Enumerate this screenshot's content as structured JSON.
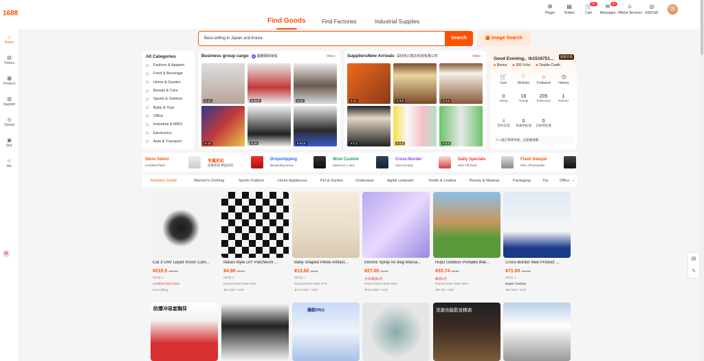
{
  "brand": {
    "logo": "1688"
  },
  "header": {
    "tabs": [
      {
        "label": "Find Goods"
      },
      {
        "label": "Find Factories"
      },
      {
        "label": "Industrial Supplies"
      }
    ],
    "tools": [
      {
        "label": "Plugin",
        "icon": "puzzle-icon"
      },
      {
        "label": "Orders",
        "icon": "orders-icon"
      },
      {
        "label": "Cart",
        "icon": "cart-icon",
        "badge": "99+"
      },
      {
        "label": "Messages",
        "icon": "message-icon",
        "badge": "99+"
      },
      {
        "label": "Official Services",
        "icon": "user-icon"
      },
      {
        "label": "EN/USD",
        "icon": "globe-icon"
      }
    ]
  },
  "sidebar": {
    "items": [
      {
        "label": "Home",
        "icon": "home-icon"
      },
      {
        "label": "Orders",
        "icon": "orders-icon"
      },
      {
        "label": "Product",
        "icon": "grid-icon"
      },
      {
        "label": "Supplier",
        "icon": "store-icon"
      },
      {
        "label": "Global",
        "icon": "globe-icon"
      },
      {
        "label": "Dist.",
        "icon": "distribution-icon"
      },
      {
        "label": "Me",
        "icon": "user-icon"
      }
    ]
  },
  "search": {
    "value": "Best-selling in Japan and Korea",
    "button": "Search",
    "image_search": "Image Search"
  },
  "categories": {
    "title": "All Categories",
    "items": [
      "Fashion & Apparel",
      "Food & Beverage",
      "Home & Garden",
      "Beauty & Care",
      "Sports & Outdoor",
      "Baby & Toys",
      "Office",
      "Industrial & MRO",
      "Electronics",
      "Auto & Transport"
    ]
  },
  "business_group": {
    "title": "Business group cargo",
    "subtitle": "超酷网袜家俱",
    "view": "View ›",
    "prices": [
      "¥ 16",
      "¥ 30.9",
      "¥ 19",
      "¥ 18",
      "¥ 25",
      "¥ 53.9"
    ]
  },
  "suppliers_new": {
    "title": "SuppliersNew Arrivals",
    "subtitle": "深圳市兴慧达科技有限公司",
    "view": "View ›",
    "prices": [
      "¥ 22",
      "¥ 3.5",
      "¥ 4.5",
      "¥ 2.2",
      "¥ 6.8",
      "¥ 6.8"
    ]
  },
  "greeting": {
    "text": "Good Evening，tb1518751...",
    "member_badge": "超级买家",
    "vouchers": [
      "Bonus",
      "300 Vchs",
      "Double Credit"
    ],
    "quick": [
      {
        "label": "Cart",
        "icon": "cart-icon"
      },
      {
        "label": "Wishlist",
        "icon": "heart-icon"
      },
      {
        "label": "Followed",
        "icon": "store-icon"
      },
      {
        "label": "History",
        "icon": "history-icon"
      }
    ],
    "stats": [
      {
        "value": "0",
        "label": "ToPay"
      },
      {
        "value": "16",
        "label": "ToShip"
      },
      {
        "value": "205",
        "label": "ToReceive"
      },
      {
        "value": "1",
        "label": "Refund"
      }
    ],
    "stats2": [
      {
        "value": "4",
        "label": "签约异常"
      },
      {
        "value": "0",
        "label": "签收待处理"
      },
      {
        "value": "0",
        "label": "已收待处理"
      }
    ],
    "notice": "1笔订单待付款，已逾期请重"
  },
  "promo_strip": [
    {
      "title": "Store Select",
      "sub": "Certified Flash",
      "color": "#ff5000"
    },
    {
      "title": "专属折扣",
      "sub": "优惠券领 特品有机",
      "color": "#ff5000"
    },
    {
      "title": "Dropshipping",
      "sub": "Bestselling items",
      "color": "#1a6cff"
    },
    {
      "title": "Wow Custom",
      "sub": "Minimum 1 Item",
      "color": "#17a34a"
    },
    {
      "title": "Cross-Border",
      "sub": "Fast Hot Buy",
      "color": "#8a3cf0"
    },
    {
      "title": "Daily Specials",
      "sub": "50% Off Rush",
      "color": "#ff2a2a"
    },
    {
      "title": "Flash Sample",
      "sub": "50% off bestseller",
      "color": "#ff5000"
    }
  ],
  "category_tabs": [
    "Selected Goods",
    "Women's Clothing",
    "Sports Outdoor",
    "Home Appliances",
    "Pet & Garden",
    "Underwear",
    "digital computer",
    "Textile & Leather",
    "Beauty & Makeup",
    "Packaging",
    "Toy",
    "Office"
  ],
  "products": [
    {
      "name": "Cat 3 UAV Liquid Vision Cam...",
      "price": "¥210.0",
      "old": "¥31.76",
      "moq": "MOQ 1",
      "tag": "Certified Merchant",
      "meta": "Hot selling"
    },
    {
      "name": "Italian-Style DIY Patchwork ...",
      "price": "¥4.90",
      "old": "¥0.73",
      "moq": "MOQ 3",
      "tag": "Repurchase Rate 83%",
      "meta": "★5   20K+ sold"
    },
    {
      "name": "Baby Shaped Pillow Artifact...",
      "price": "¥13.60",
      "old": "¥2.38",
      "moq": "MOQ 1",
      "tag": "Repurchase Rate 47%",
      "meta": "★4.8   20K+ sold"
    },
    {
      "name": "Electric Spray Air Bag Massa...",
      "price": "¥27.00",
      "old": "¥4.08",
      "moq": "分享再减2元",
      "tag": "Repurchase Rate 50%",
      "meta": "★3.8   38K+ sold"
    },
    {
      "name": "Hupu Outdoor Portable Wat...",
      "price": "¥33.74",
      "old": "¥5.30",
      "moq": "再减2元",
      "tag": "Repurchase Rate 65%",
      "meta": "★5   2K+ sold"
    },
    {
      "name": "Cross-Border New Product ...",
      "price": "¥71.00",
      "old": "¥10.72",
      "moq": "MOQ 1",
      "tag": "Super Factory",
      "meta": "★5   80K+ sold"
    }
  ],
  "row2_labels": [
    "防爆冲易套胸背",
    "",
    "爆款PRO",
    "",
    "洗漱也能影显精调",
    ""
  ],
  "colors": {
    "accent": "#ff5000",
    "bg": "#f5f5f5"
  }
}
